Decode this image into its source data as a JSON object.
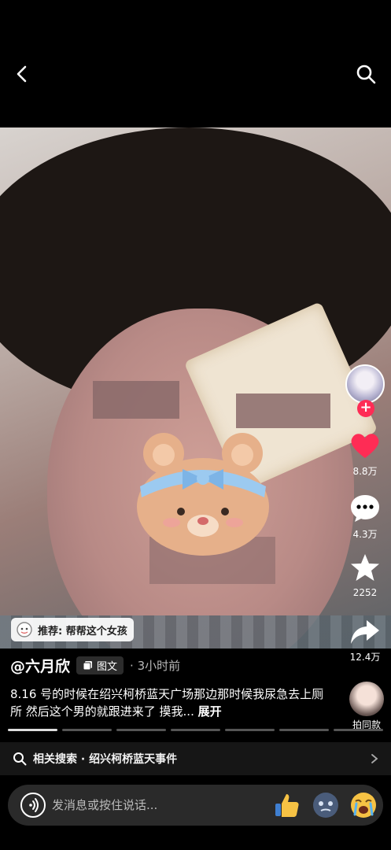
{
  "icons": {
    "back": "chevron-left-icon",
    "search": "search-icon",
    "like": "heart-icon",
    "comment": "comment-icon",
    "favorite": "star-icon",
    "share": "share-icon",
    "voice": "voice-icon",
    "photo_tag": "image-stack-icon"
  },
  "colors": {
    "like": "#fe2c55",
    "follow": "#fe2c55",
    "background": "#000000"
  },
  "actions": {
    "likes": "8.8万",
    "comments": "4.3万",
    "favorites": "2252",
    "shares": "12.4万"
  },
  "recommend": {
    "label": "推荐: 帮帮这个女孩"
  },
  "post": {
    "author": "@六月欣",
    "type_tag": "图文",
    "time": "· 3小时前",
    "caption": "8.16 号的时候在绍兴柯桥蓝天广场那边那时候我尿急去上厕所 然后这个男的就跟进来了 摸我...",
    "expand": "展开",
    "same_style": "拍同款"
  },
  "progress": {
    "segments": 7,
    "active_index": 0
  },
  "related": {
    "label": "相关搜索 · 绍兴柯桥蓝天事件"
  },
  "input": {
    "placeholder": "发消息或按住说话..."
  }
}
